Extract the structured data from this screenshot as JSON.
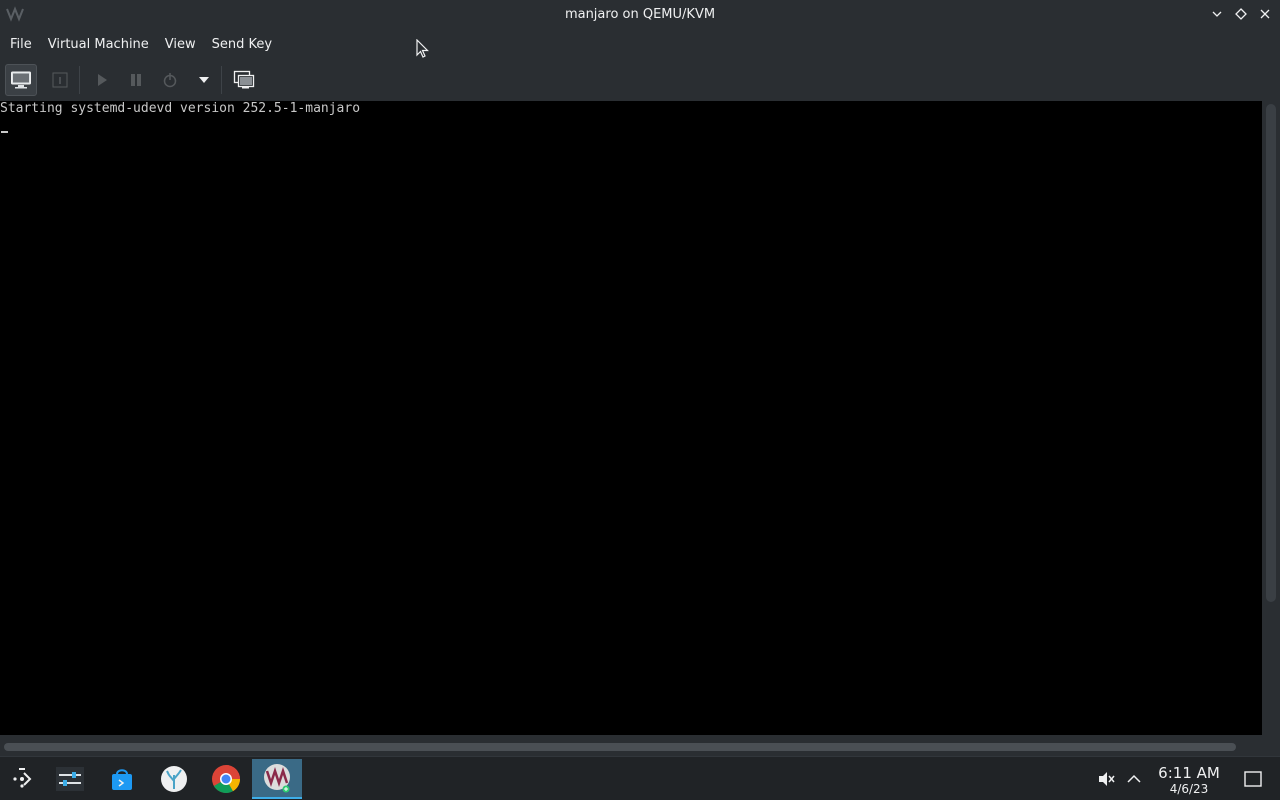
{
  "window": {
    "title": "manjaro on QEMU/KVM",
    "app_icon": "virt-manager-icon",
    "controls": [
      "minimize-icon",
      "maximize-icon",
      "close-icon"
    ]
  },
  "menubar": {
    "items": [
      {
        "label": "File"
      },
      {
        "label": "Virtual Machine"
      },
      {
        "label": "View"
      },
      {
        "label": "Send Key"
      }
    ]
  },
  "toolbar": {
    "buttons": [
      {
        "icon": "console-monitor-icon",
        "state": "active"
      },
      {
        "icon": "details-info-icon",
        "state": "disabled"
      },
      {
        "icon": "run-icon",
        "state": "disabled"
      },
      {
        "icon": "pause-icon",
        "state": "disabled"
      },
      {
        "icon": "shutdown-icon",
        "state": "disabled"
      },
      {
        "icon": "chevron-down-icon",
        "state": "enabled"
      },
      {
        "icon": "fullscreen-icon",
        "state": "enabled"
      }
    ]
  },
  "console": {
    "lines": [
      "Starting systemd-udevd version 252.5-1-manjaro"
    ],
    "cursor": "_"
  },
  "taskbar": {
    "launcher_icon": "application-launcher-icon",
    "apps": [
      {
        "icon": "system-settings-icon"
      },
      {
        "icon": "software-store-icon"
      },
      {
        "icon": "coral-app-icon"
      },
      {
        "icon": "chrome-icon"
      },
      {
        "icon": "virt-manager-icon",
        "active": true
      }
    ],
    "tray": {
      "volume_icon": "volume-muted-icon",
      "expand_icon": "chevron-up-icon",
      "time": "6:11 AM",
      "date": "4/6/23",
      "show_desktop_icon": "show-desktop-icon"
    }
  },
  "colors": {
    "window_bg": "#2a2e32",
    "console_bg": "#000000",
    "console_text": "#c8c8c8",
    "taskbar_bg": "#202326",
    "accent": "#3daee9"
  }
}
